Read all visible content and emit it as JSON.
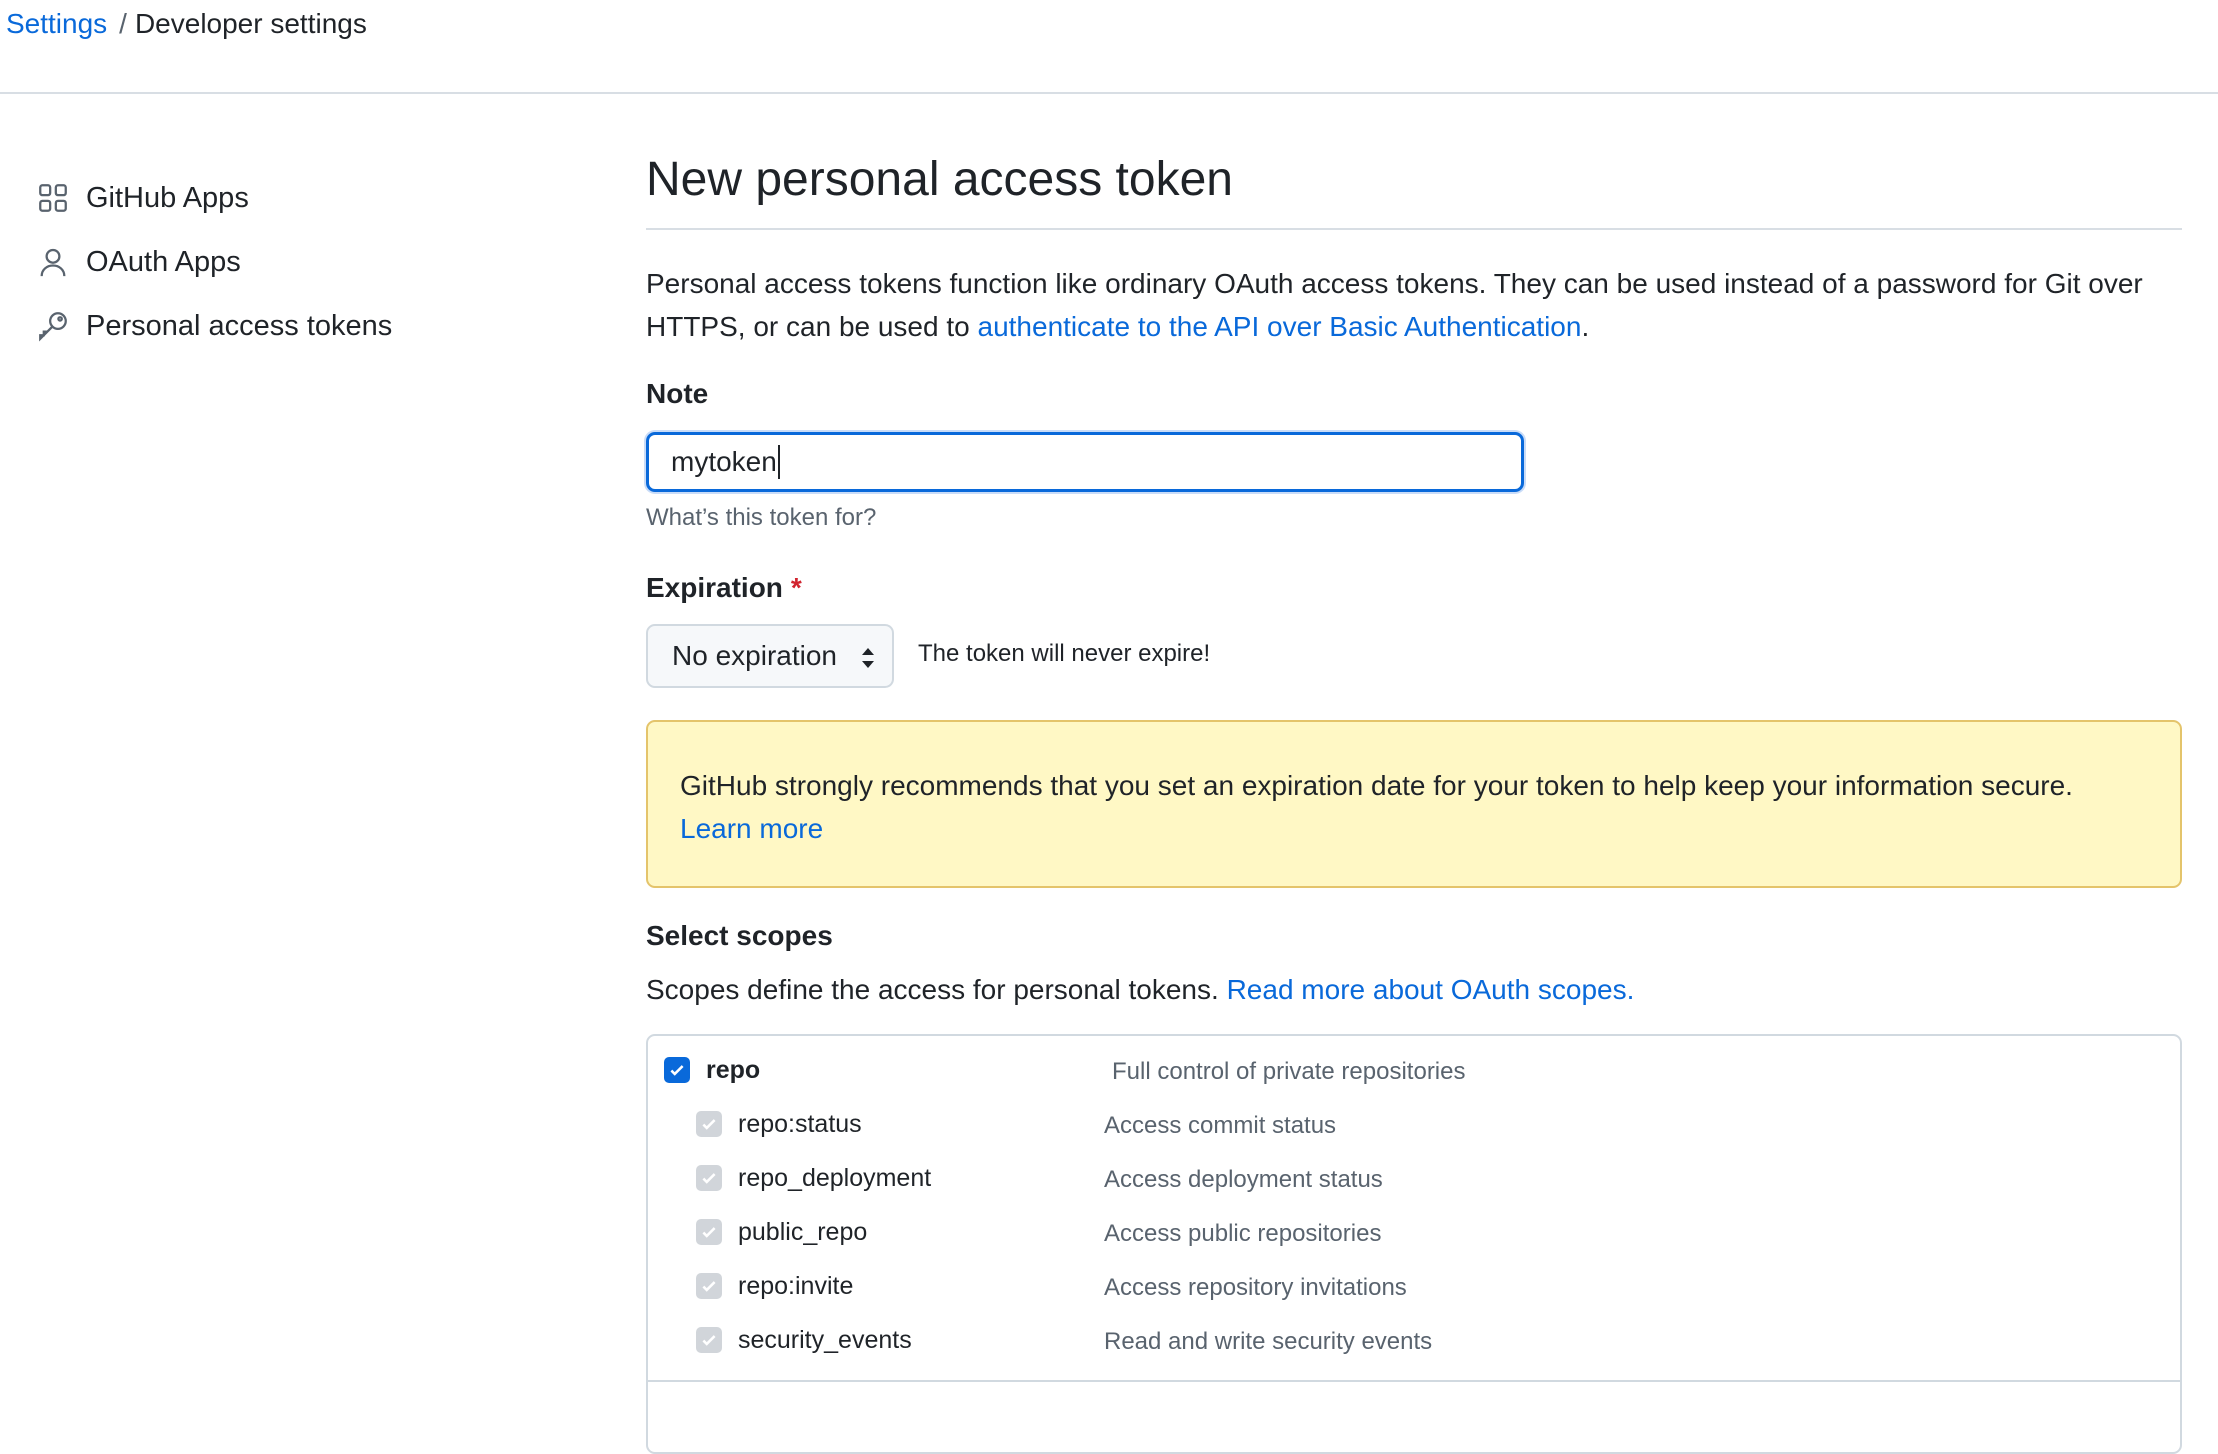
{
  "breadcrumb": {
    "root": "Settings",
    "separator": "/",
    "current": "Developer settings"
  },
  "sidebar": {
    "items": [
      {
        "label": "GitHub Apps",
        "icon": "apps-grid-icon"
      },
      {
        "label": "OAuth Apps",
        "icon": "person-icon"
      },
      {
        "label": "Personal access tokens",
        "icon": "key-icon"
      }
    ]
  },
  "page": {
    "title": "New personal access token",
    "intro_text": "Personal access tokens function like ordinary OAuth access tokens. They can be used instead of a password for Git over HTTPS, or can be used to ",
    "intro_link": "authenticate to the API over Basic Authentication",
    "intro_end": "."
  },
  "note": {
    "label": "Note",
    "value": "mytoken",
    "hint": "What’s this token for?"
  },
  "expiration": {
    "label": "Expiration",
    "required_marker": "*",
    "selected": "No expiration",
    "message": "The token will never expire!"
  },
  "warning": {
    "text": "GitHub strongly recommends that you set an expiration date for your token to help keep your information secure.",
    "link": "Learn more"
  },
  "scopes": {
    "heading": "Select scopes",
    "description": "Scopes define the access for personal tokens.",
    "link": "Read more about OAuth scopes.",
    "items": [
      {
        "name": "repo",
        "description": "Full control of private repositories",
        "checked": true,
        "disabled": false
      },
      {
        "name": "repo:status",
        "description": "Access commit status",
        "checked": true,
        "disabled": true
      },
      {
        "name": "repo_deployment",
        "description": "Access deployment status",
        "checked": true,
        "disabled": true
      },
      {
        "name": "public_repo",
        "description": "Access public repositories",
        "checked": true,
        "disabled": true
      },
      {
        "name": "repo:invite",
        "description": "Access repository invitations",
        "checked": true,
        "disabled": true
      },
      {
        "name": "security_events",
        "description": "Read and write security events",
        "checked": true,
        "disabled": true
      }
    ]
  },
  "colors": {
    "link": "#0969da",
    "focus": "#0969da",
    "warning_bg": "#fff8c5",
    "required": "#d1242f"
  }
}
